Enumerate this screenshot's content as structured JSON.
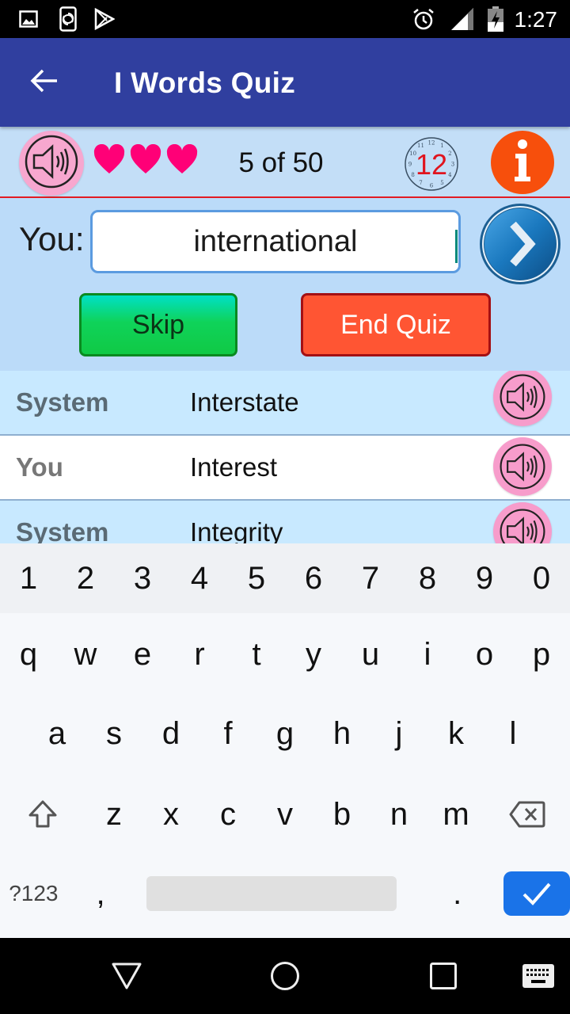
{
  "status_bar": {
    "left_icons": [
      "image-icon",
      "screen-rotation-icon",
      "play-store-icon"
    ],
    "right_icons": [
      "alarm-icon",
      "signal-icon",
      "battery-charging-icon"
    ],
    "time": "1:27"
  },
  "app_bar": {
    "back_icon": "arrow-back-icon",
    "title": "I Words Quiz"
  },
  "quiz": {
    "lives": 3,
    "hearts": [
      "heart",
      "heart",
      "heart"
    ],
    "counter": "5 of 50",
    "timer_value": "12",
    "clock_numbers": [
      "12",
      "1",
      "2",
      "3",
      "4",
      "5",
      "6",
      "7",
      "8",
      "9",
      "10",
      "11"
    ],
    "answer_label": "You:",
    "answer_value": "international",
    "skip_label": "Skip",
    "end_quiz_label": "End Quiz",
    "colors": {
      "app_bar": "#303F9F",
      "heart": "#FF0077",
      "info": "#F74F0C",
      "timer_text": "#E0141E",
      "skip": "#10C945",
      "end_quiz": "#FF5533",
      "divider": "#E31B23"
    }
  },
  "history": [
    {
      "who": "System",
      "word": "Interstate",
      "type": "system"
    },
    {
      "who": "You",
      "word": "Interest",
      "type": "you"
    },
    {
      "who": "System",
      "word": "Integrity",
      "type": "system"
    }
  ],
  "keyboard": {
    "numbers": [
      "1",
      "2",
      "3",
      "4",
      "5",
      "6",
      "7",
      "8",
      "9",
      "0"
    ],
    "row1": [
      "q",
      "w",
      "e",
      "r",
      "t",
      "y",
      "u",
      "i",
      "o",
      "p"
    ],
    "row2": [
      "a",
      "s",
      "d",
      "f",
      "g",
      "h",
      "j",
      "k",
      "l"
    ],
    "row3": [
      "z",
      "x",
      "c",
      "v",
      "b",
      "n",
      "m"
    ],
    "symbols_label": "?123",
    "comma": ",",
    "period": ".",
    "done_color": "#1A73E8"
  },
  "nav_bar": {
    "buttons": [
      "back",
      "home",
      "recents",
      "keyboard-switch"
    ]
  }
}
